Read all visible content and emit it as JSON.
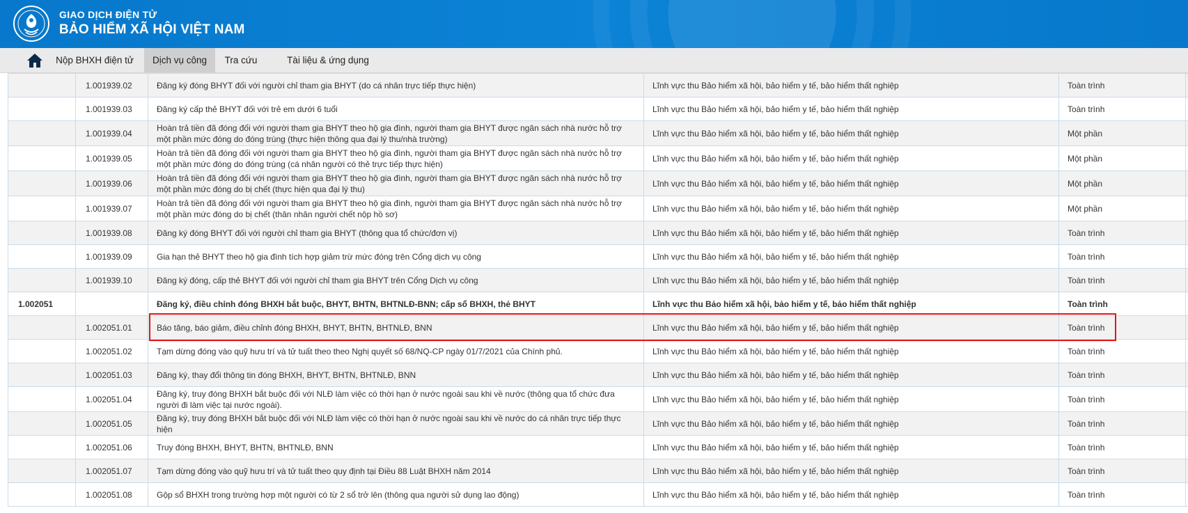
{
  "header": {
    "brand_line1": "GIAO DỊCH ĐIỆN TỬ",
    "brand_line2": "BẢO HIỂM XÃ HỘI VIỆT NAM",
    "logo_icon": "bhxh-logo-icon",
    "accent_color": "#0a7fd3"
  },
  "nav": {
    "home_icon": "home-icon",
    "items": [
      {
        "label": "Nộp BHXH điện tử"
      },
      {
        "label": "Dịch vụ công",
        "active": true
      },
      {
        "label": "Tra cứu"
      },
      {
        "label": "Tài liệu & ứng dụng"
      }
    ]
  },
  "table": {
    "rows": [
      {
        "group": "",
        "code": "1.001939.02",
        "name": "Đăng ký đóng BHYT đối với người chỉ tham gia BHYT (do cá nhân trực tiếp thực hiện)",
        "field": "Lĩnh vực thu Bảo hiểm xã hội, bảo hiểm y tế, bảo hiểm thất nghiệp",
        "level": "Toàn trình"
      },
      {
        "group": "",
        "code": "1.001939.03",
        "name": "Đăng ký cấp thẻ BHYT đối với trẻ em dưới 6 tuổi",
        "field": "Lĩnh vực thu Bảo hiểm xã hội, bảo hiểm y tế, bảo hiểm thất nghiệp",
        "level": "Toàn trình"
      },
      {
        "group": "",
        "code": "1.001939.04",
        "name": "Hoàn trả tiền đã đóng đối với người tham gia BHYT theo hộ gia đình, người tham gia BHYT được ngân sách nhà nước hỗ trợ một phần mức đóng do đóng trùng (thực hiện thông qua đại lý thu/nhà trường)",
        "field": "Lĩnh vực thu Bảo hiểm xã hội, bảo hiểm y tế, bảo hiểm thất nghiệp",
        "level": "Một phần"
      },
      {
        "group": "",
        "code": "1.001939.05",
        "name": "Hoàn trả tiền đã đóng đối với người tham gia BHYT theo hộ gia đình, người tham gia BHYT được ngân sách nhà nước hỗ trợ một phần mức đóng do đóng trùng (cá nhân người có thẻ trực tiếp thực hiện)",
        "field": "Lĩnh vực thu Bảo hiểm xã hội, bảo hiểm y tế, bảo hiểm thất nghiệp",
        "level": "Một phần"
      },
      {
        "group": "",
        "code": "1.001939.06",
        "name": "Hoàn trả tiền đã đóng đối với người tham gia BHYT theo hộ gia đình, người tham gia BHYT được ngân sách nhà nước hỗ trợ một phần mức đóng do bị chết (thực hiện qua đại lý thu)",
        "field": "Lĩnh vực thu Bảo hiểm xã hội, bảo hiểm y tế, bảo hiểm thất nghiệp",
        "level": "Một phần"
      },
      {
        "group": "",
        "code": "1.001939.07",
        "name": "Hoàn trả tiền đã đóng đối với người tham gia BHYT theo hộ gia đình, người tham gia BHYT được ngân sách nhà nước hỗ trợ một phần mức đóng do bị chết (thân nhân người chết nộp hồ sơ)",
        "field": "Lĩnh vực thu Bảo hiểm xã hội, bảo hiểm y tế, bảo hiểm thất nghiệp",
        "level": "Một phần"
      },
      {
        "group": "",
        "code": "1.001939.08",
        "name": "Đăng ký đóng BHYT đối với người chỉ tham gia BHYT (thông qua tổ chức/đơn vị)",
        "field": "Lĩnh vực thu Bảo hiểm xã hội, bảo hiểm y tế, bảo hiểm thất nghiệp",
        "level": "Toàn trình"
      },
      {
        "group": "",
        "code": "1.001939.09",
        "name": "Gia hạn thẻ BHYT theo hộ gia đình tích hợp giảm trừ mức đóng trên Cổng dịch vụ công",
        "field": "Lĩnh vực thu Bảo hiểm xã hội, bảo hiểm y tế, bảo hiểm thất nghiệp",
        "level": "Toàn trình"
      },
      {
        "group": "",
        "code": "1.001939.10",
        "name": "Đăng ký đóng, cấp thẻ BHYT đối với người chỉ tham gia BHYT trên Cổng Dịch vụ công",
        "field": "Lĩnh vực thu Bảo hiểm xã hội, bảo hiểm y tế, bảo hiểm thất nghiệp",
        "level": "Toàn trình"
      },
      {
        "group": "1.002051",
        "code": "",
        "name": "Đăng ký, điều chỉnh đóng BHXH bắt buộc, BHYT, BHTN, BHTNLĐ-BNN; cấp sổ BHXH, thẻ BHYT",
        "field": "Lĩnh vực thu Bảo hiểm xã hội, bảo hiểm y tế, bảo hiểm thất nghiệp",
        "level": "Toàn trình"
      },
      {
        "group": "",
        "code": "1.002051.01",
        "name": "Báo tăng, báo giảm, điều chỉnh đóng BHXH, BHYT, BHTN, BHTNLĐ, BNN",
        "field": "Lĩnh vực thu Bảo hiểm xã hội, bảo hiểm y tế, bảo hiểm thất nghiệp",
        "level": "Toàn trình"
      },
      {
        "group": "",
        "code": "1.002051.02",
        "name": "Tạm dừng đóng vào quỹ hưu trí và tử tuất theo theo Nghị quyết số 68/NQ-CP ngày 01/7/2021 của Chính phủ.",
        "field": "Lĩnh vực thu Bảo hiểm xã hội, bảo hiểm y tế, bảo hiểm thất nghiệp",
        "level": "Toàn trình"
      },
      {
        "group": "",
        "code": "1.002051.03",
        "name": "Đăng ký, thay đổi thông tin đóng BHXH, BHYT, BHTN, BHTNLĐ, BNN",
        "field": "Lĩnh vực thu Bảo hiểm xã hội, bảo hiểm y tế, bảo hiểm thất nghiệp",
        "level": "Toàn trình"
      },
      {
        "group": "",
        "code": "1.002051.04",
        "name": "Đăng ký, truy đóng BHXH bắt buộc đối với NLĐ làm việc có thời hạn ở nước ngoài sau khi về nước (thông qua tổ chức đưa người đi làm việc tại nước ngoài).",
        "field": "Lĩnh vực thu Bảo hiểm xã hội, bảo hiểm y tế, bảo hiểm thất nghiệp",
        "level": "Toàn trình"
      },
      {
        "group": "",
        "code": "1.002051.05",
        "name": "Đăng ký, truy đóng BHXH bắt buộc đối với NLĐ làm việc có thời hạn ở nước ngoài sau khi về nước do cá nhân trực tiếp thực hiện",
        "field": "Lĩnh vực thu Bảo hiểm xã hội, bảo hiểm y tế, bảo hiểm thất nghiệp",
        "level": "Toàn trình"
      },
      {
        "group": "",
        "code": "1.002051.06",
        "name": "Truy đóng BHXH, BHYT, BHTN, BHTNLĐ, BNN",
        "field": "Lĩnh vực thu Bảo hiểm xã hội, bảo hiểm y tế, bảo hiểm thất nghiệp",
        "level": "Toàn trình"
      },
      {
        "group": "",
        "code": "1.002051.07",
        "name": "Tạm dừng đóng vào quỹ hưu trí và tử tuất theo quy định tại Điều 88 Luật BHXH năm 2014",
        "field": "Lĩnh vực thu Bảo hiểm xã hội, bảo hiểm y tế, bảo hiểm thất nghiệp",
        "level": "Toàn trình"
      },
      {
        "group": "",
        "code": "1.002051.08",
        "name": "Gộp sổ BHXH trong trường hợp một người có từ 2 sổ trở lên (thông qua người sử dụng lao động)",
        "field": "Lĩnh vực thu Bảo hiểm xã hội, bảo hiểm y tế, bảo hiểm thất nghiệp",
        "level": "Toàn trình"
      }
    ],
    "highlighted_code": "1.002051.01",
    "highlight_color": "#e3151a"
  }
}
